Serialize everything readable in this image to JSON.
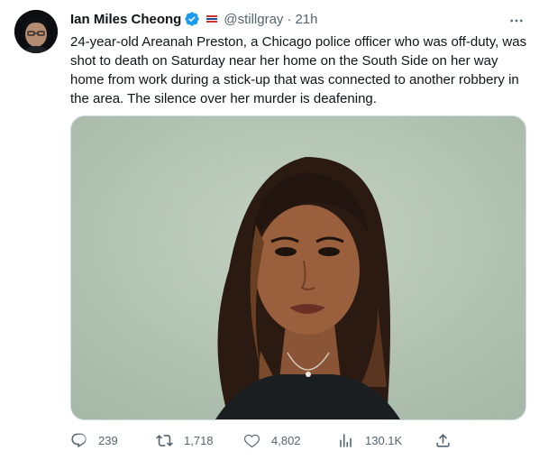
{
  "tweet": {
    "author": {
      "name": "Ian Miles Cheong",
      "handle": "@stillgray",
      "separator": "·",
      "time": "21h"
    },
    "text": "24-year-old Areanah Preston, a Chicago police officer who was off-duty, was shot to death on Saturday near her home on the South Side on her way home from work during a stick-up that was connected to another robbery in the area. The silence over her murder is deafening.",
    "media_description": "photo",
    "actions": {
      "replies": "239",
      "retweets": "1,718",
      "likes": "4,802",
      "views": "130.1K"
    }
  },
  "icons": {
    "verified": "verified-badge-icon",
    "affiliation": "affiliate-badge-icon",
    "more": "more-icon",
    "reply": "reply-icon",
    "retweet": "retweet-icon",
    "like": "heart-icon",
    "views": "views-icon",
    "share": "share-icon"
  },
  "colors": {
    "text": "#0f1419",
    "muted": "#536471",
    "verified": "#1d9bf0",
    "border": "#cfd9de"
  }
}
